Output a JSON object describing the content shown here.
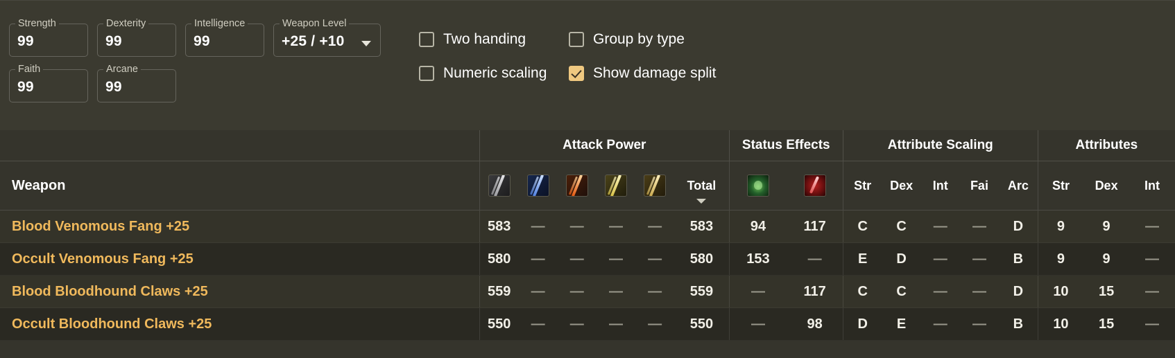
{
  "colors": {
    "panel_bg": "#3b3a30",
    "table_bg": "#2f2e27",
    "row_odd": "#343329",
    "row_even": "#2a2922",
    "weapon_name": "#f0b95c",
    "checkbox_accent": "#efc880",
    "text": "#ffffff"
  },
  "filters": {
    "stats": [
      {
        "label": "Strength",
        "value": "99"
      },
      {
        "label": "Dexterity",
        "value": "99"
      },
      {
        "label": "Intelligence",
        "value": "99"
      },
      {
        "label": "Faith",
        "value": "99"
      },
      {
        "label": "Arcane",
        "value": "99"
      }
    ],
    "weapon_level": {
      "label": "Weapon Level",
      "value": "+25 / +10",
      "icon": "chevron-down-icon"
    },
    "checkboxes": [
      {
        "label": "Two handing",
        "checked": false
      },
      {
        "label": "Group by type",
        "checked": false
      },
      {
        "label": "Numeric scaling",
        "checked": false
      },
      {
        "label": "Show damage split",
        "checked": true
      }
    ]
  },
  "table": {
    "groups": [
      {
        "label": "",
        "span": 1
      },
      {
        "label": "Attack Power",
        "span": 6
      },
      {
        "label": "Status Effects",
        "span": 2
      },
      {
        "label": "Attribute Scaling",
        "span": 5
      },
      {
        "label": "Attributes",
        "span": 3
      }
    ],
    "subheaders": {
      "weapon": "Weapon",
      "attack_icons": [
        {
          "name": "physical-damage-icon",
          "kind": "phys"
        },
        {
          "name": "magic-damage-icon",
          "kind": "magic"
        },
        {
          "name": "fire-damage-icon",
          "kind": "fire"
        },
        {
          "name": "lightning-damage-icon",
          "kind": "light"
        },
        {
          "name": "holy-damage-icon",
          "kind": "holy"
        }
      ],
      "total": "Total",
      "sort_indicator": "sort-descending-icon",
      "status_icons": [
        {
          "name": "poison-status-icon",
          "kind": "poison"
        },
        {
          "name": "bleed-status-icon",
          "kind": "bleed"
        }
      ],
      "scaling": [
        "Str",
        "Dex",
        "Int",
        "Fai",
        "Arc"
      ],
      "attributes": [
        "Str",
        "Dex",
        "Int"
      ]
    },
    "rows": [
      {
        "weapon": "Blood Venomous Fang +25",
        "attack": [
          "583",
          "—",
          "—",
          "—",
          "—"
        ],
        "total": "583",
        "status": [
          "94",
          "117"
        ],
        "scaling": [
          "C",
          "C",
          "—",
          "—",
          "D"
        ],
        "attributes": [
          "9",
          "9",
          "—"
        ]
      },
      {
        "weapon": "Occult Venomous Fang +25",
        "attack": [
          "580",
          "—",
          "—",
          "—",
          "—"
        ],
        "total": "580",
        "status": [
          "153",
          "—"
        ],
        "scaling": [
          "E",
          "D",
          "—",
          "—",
          "B"
        ],
        "attributes": [
          "9",
          "9",
          "—"
        ]
      },
      {
        "weapon": "Blood Bloodhound Claws +25",
        "attack": [
          "559",
          "—",
          "—",
          "—",
          "—"
        ],
        "total": "559",
        "status": [
          "—",
          "117"
        ],
        "scaling": [
          "C",
          "C",
          "—",
          "—",
          "D"
        ],
        "attributes": [
          "10",
          "15",
          "—"
        ]
      },
      {
        "weapon": "Occult Bloodhound Claws +25",
        "attack": [
          "550",
          "—",
          "—",
          "—",
          "—"
        ],
        "total": "550",
        "status": [
          "—",
          "98"
        ],
        "scaling": [
          "D",
          "E",
          "—",
          "—",
          "B"
        ],
        "attributes": [
          "10",
          "15",
          "—"
        ]
      }
    ]
  }
}
